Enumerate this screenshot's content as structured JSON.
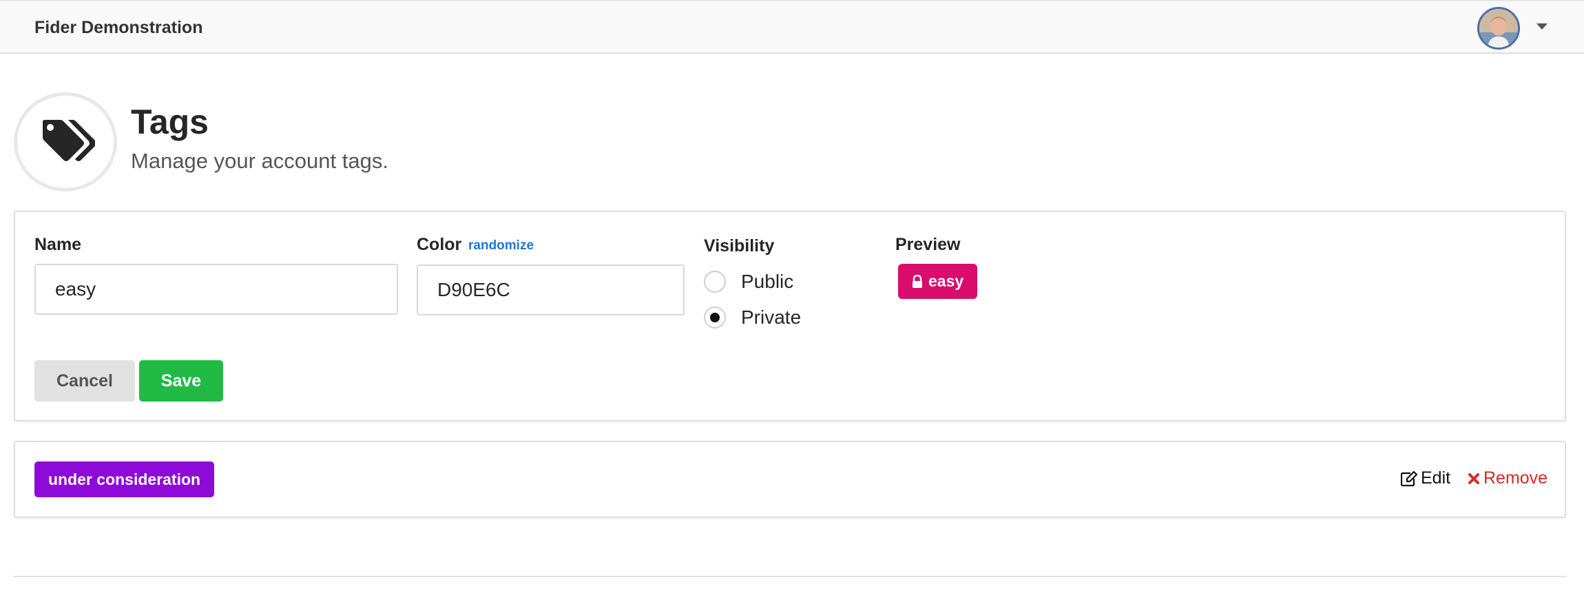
{
  "header": {
    "brand": "Fider Demonstration",
    "avatar_icon": "user-avatar",
    "menu_icon": "caret-down-icon"
  },
  "page": {
    "icon": "tags-icon",
    "title": "Tags",
    "subtitle": "Manage your account tags."
  },
  "form": {
    "name_label": "Name",
    "name_value": "easy",
    "color_label": "Color",
    "randomize_label": "randomize",
    "color_value": "D90E6C",
    "visibility_label": "Visibility",
    "visibility_options": [
      {
        "label": "Public",
        "checked": false
      },
      {
        "label": "Private",
        "checked": true
      }
    ],
    "preview_label": "Preview",
    "preview_tag": {
      "text": "easy",
      "color": "#d90e6c",
      "icon": "lock-icon"
    },
    "cancel_label": "Cancel",
    "save_label": "Save"
  },
  "tags": [
    {
      "text": "under consideration",
      "color": "#8e0ad8",
      "edit_label": "Edit",
      "remove_label": "Remove"
    }
  ],
  "colors": {
    "save_button": "#21ba45",
    "cancel_button": "#e1e1e1",
    "link": "#1f76d6",
    "remove": "#db2828"
  }
}
